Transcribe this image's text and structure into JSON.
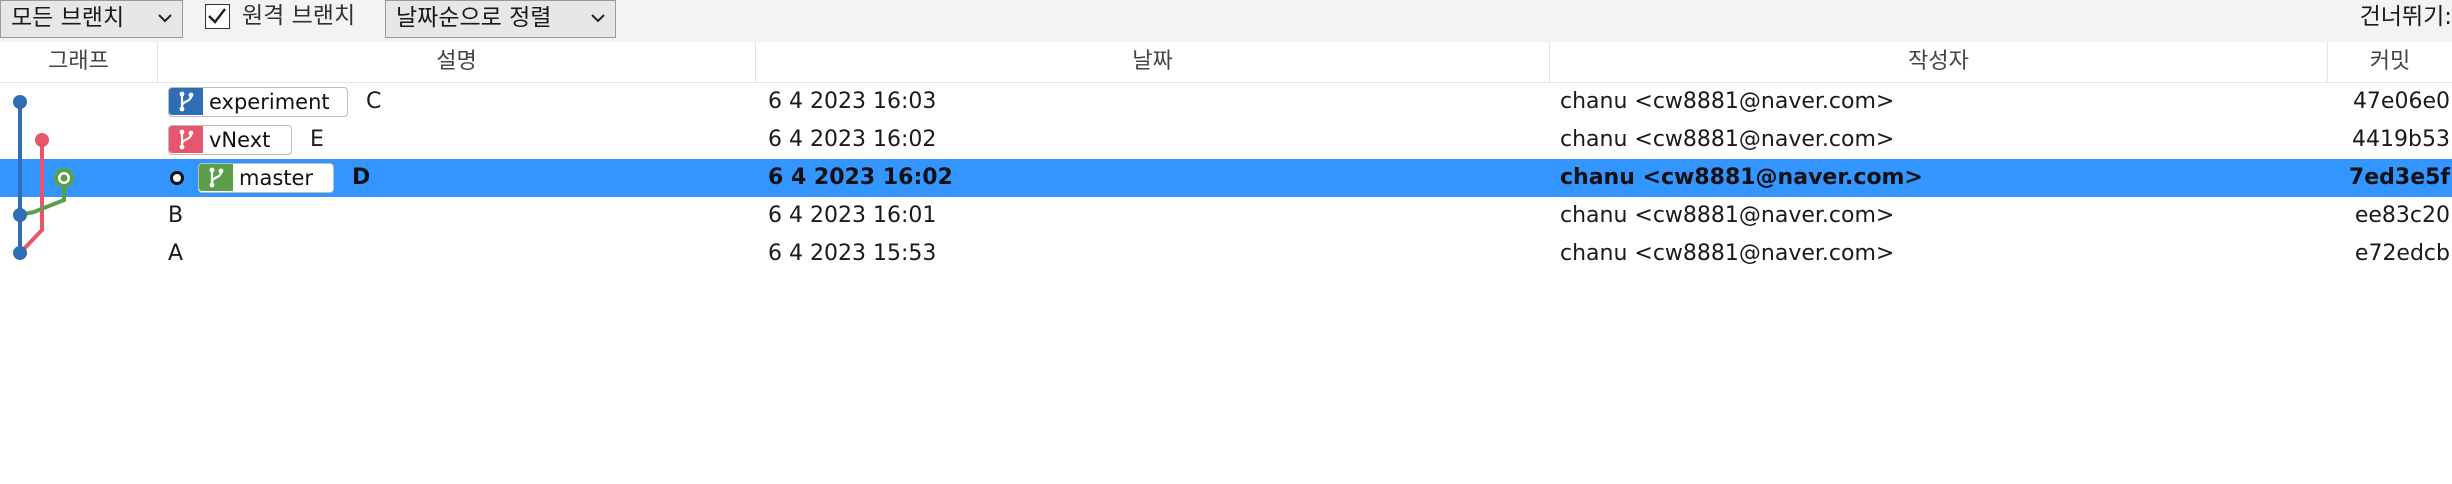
{
  "toolbar": {
    "branch_filter": "모든 브랜치",
    "remote_branches_label": "원격 브랜치",
    "remote_branches_checked": true,
    "sort": "날짜순으로 정렬",
    "skip_label": "건너뛰기:"
  },
  "columns": {
    "graph": "그래프",
    "description": "설명",
    "date": "날짜",
    "author": "작성자",
    "commit": "커밋"
  },
  "branch_colors": {
    "experiment": "#2f6db5",
    "vNext": "#e8566d",
    "master": "#5aa04a"
  },
  "selection_color": "#3395ff",
  "commits": [
    {
      "branch": "experiment",
      "subject": "C",
      "date": "6 4 2023 16:03",
      "author": "chanu <cw8881@naver.com>",
      "commit": "47e06e0"
    },
    {
      "branch": "vNext",
      "subject": "E",
      "date": "6 4 2023 16:02",
      "author": "chanu <cw8881@naver.com>",
      "commit": "4419b53"
    },
    {
      "branch": "master",
      "subject": "D",
      "date": "6 4 2023 16:02",
      "author": "chanu <cw8881@naver.com>",
      "commit": "7ed3e5f",
      "selected": true,
      "head": true
    },
    {
      "branch": "",
      "subject": "B",
      "date": "6 4 2023 16:01",
      "author": "chanu <cw8881@naver.com>",
      "commit": "ee83c20"
    },
    {
      "branch": "",
      "subject": "A",
      "date": "6 4 2023 15:53",
      "author": "chanu <cw8881@naver.com>",
      "commit": "e72edcb"
    }
  ]
}
